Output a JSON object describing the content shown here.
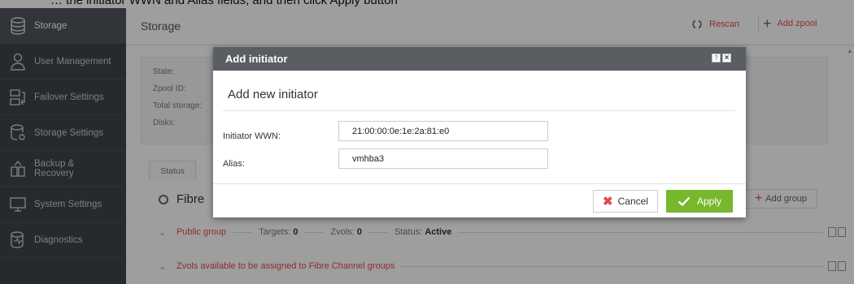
{
  "top_instruction": "… the initiator WWN and Alias fields, and then click Apply button",
  "sidebar": {
    "items": [
      {
        "label": "Storage",
        "icon": "storage-icon",
        "active": true
      },
      {
        "label": "User Management",
        "icon": "user-icon"
      },
      {
        "label": "Failover Settings",
        "icon": "failover-icon"
      },
      {
        "label": "Storage Settings",
        "icon": "storage-settings-icon"
      },
      {
        "label": "Backup & Recovery",
        "label_line1": "Backup &",
        "label_line2": "Recovery",
        "icon": "backup-icon"
      },
      {
        "label": "System Settings",
        "icon": "system-settings-icon"
      },
      {
        "label": "Diagnostics",
        "icon": "diagnostics-icon"
      }
    ]
  },
  "header": {
    "title": "Storage",
    "rescan_label": "Rescan",
    "add_zpool_label": "Add zpool"
  },
  "info": {
    "labels": [
      "State:",
      "Zpool ID:",
      "Total storage:",
      "Disks:"
    ]
  },
  "tabs": {
    "status": "Status"
  },
  "fibre": {
    "title": "Fibre",
    "add_group_label": "Add group"
  },
  "groups": [
    {
      "name": "Public group",
      "targets_label": "Targets:",
      "targets": "0",
      "zvols_label": "Zvols:",
      "zvols": "0",
      "status_label": "Status:",
      "status": "Active"
    },
    {
      "name": "Zvols available to be assigned to Fibre Channel groups"
    }
  ],
  "dialog": {
    "title": "Add initiator",
    "heading": "Add new initiator",
    "help_glyph": "?",
    "close_glyph": "×",
    "fields": {
      "wwn_label": "Initiator WWN:",
      "wwn_value": "21:00:00:0e:1e:2a:81:e0",
      "alias_label": "Alias:",
      "alias_value": "vmhba3"
    },
    "cancel_label": "Cancel",
    "apply_label": "Apply"
  },
  "colors": {
    "accent": "#e6484f",
    "apply_green": "#77b82d",
    "sidebar_bg": "#3f4449",
    "titlebar_bg": "#5a5e62"
  }
}
